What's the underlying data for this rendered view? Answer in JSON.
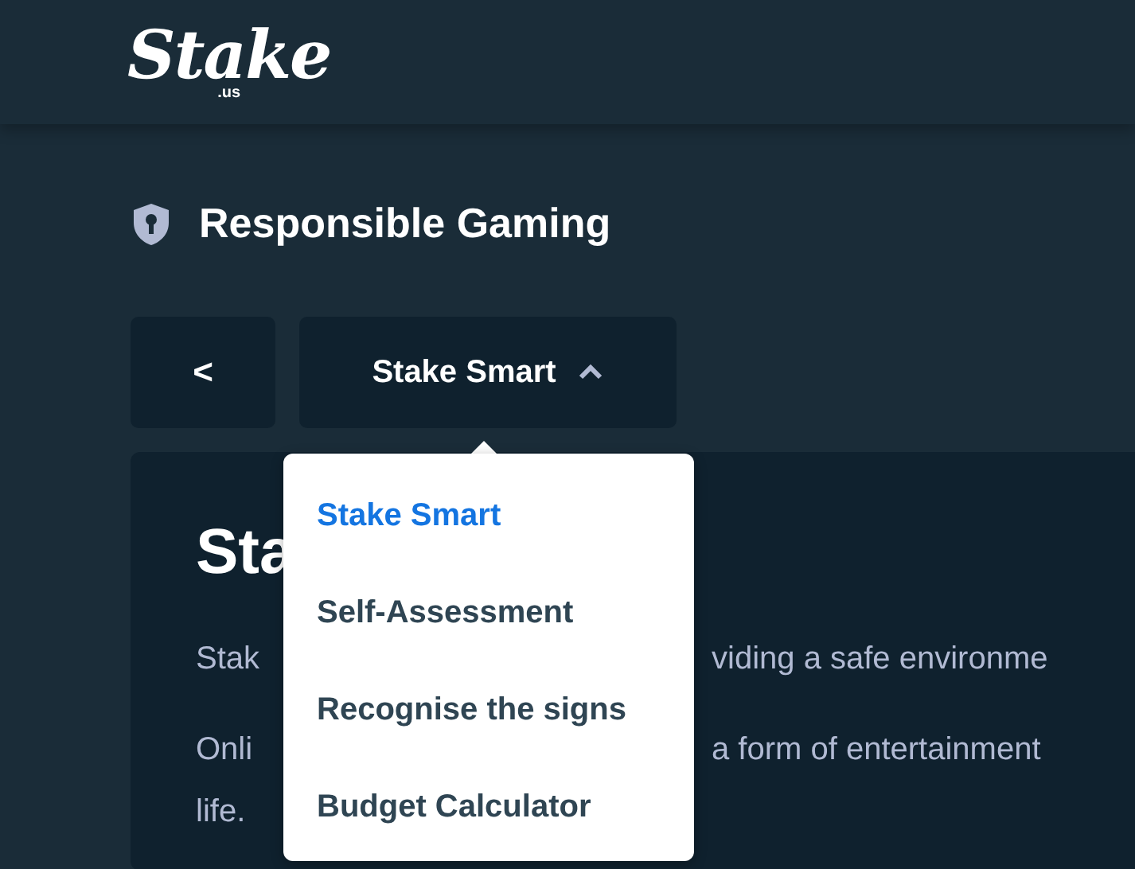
{
  "header": {
    "logo": "Stake",
    "logo_suffix": ".us"
  },
  "page_title": "Responsible Gaming",
  "nav": {
    "back": "<",
    "dropdown": {
      "label": "Stake Smart",
      "expanded": true
    }
  },
  "menu": {
    "items": [
      {
        "label": "Stake Smart",
        "selected": true
      },
      {
        "label": "Self-Assessment",
        "selected": false
      },
      {
        "label": "Recognise the signs",
        "selected": false
      },
      {
        "label": "Budget Calculator",
        "selected": false
      }
    ]
  },
  "content": {
    "heading": "Sta",
    "lines": [
      {
        "left": "Stak",
        "right": "viding a safe environme"
      },
      {
        "left": "Onli",
        "right": "a form of entertainment"
      },
      {
        "left": "life."
      }
    ]
  }
}
